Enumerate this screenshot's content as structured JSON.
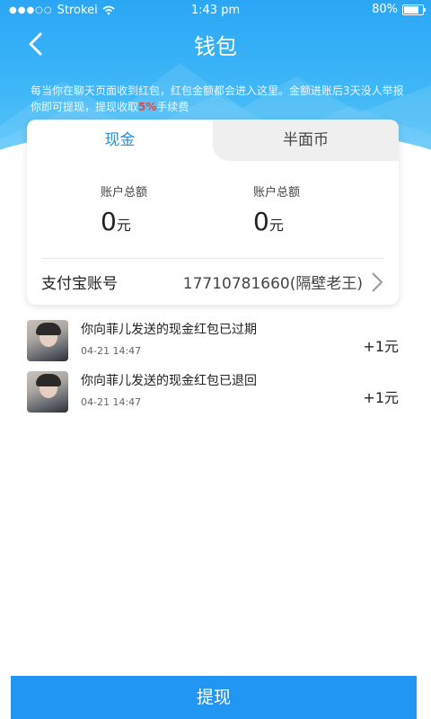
{
  "status_bar": {
    "carrier": "Strokei",
    "time": "1:43 pm",
    "battery": "80%"
  },
  "header": {
    "title": "钱包"
  },
  "notice": {
    "text_before": "每当你在聊天页面收到红包，红包金额都会进入这里。金额进账后3天没人举报你即可提现，提现收取",
    "highlight": "5%",
    "text_after": "手续费"
  },
  "tabs": [
    {
      "label": "现金"
    },
    {
      "label": "半面币"
    }
  ],
  "balances": {
    "cash": {
      "label": "账户总额",
      "amount": "0",
      "unit": "元"
    },
    "coin": {
      "label": "账户总额",
      "amount": "0",
      "unit": "元"
    }
  },
  "alipay": {
    "label": "支付宝账号",
    "value": "17710781660(隔壁老王)"
  },
  "transactions": [
    {
      "title": "你向菲儿发送的现金红包已过期",
      "time": "04-21 14:47",
      "amount": "+1元"
    },
    {
      "title": "你向菲儿发送的现金红包已退回",
      "time": "04-21 14:47",
      "amount": "+1元"
    }
  ],
  "footer": {
    "withdraw_label": "提现"
  },
  "colors": {
    "header": "#2aa6f5",
    "accent": "#2196f3",
    "tab_active": "#2a8de0",
    "highlight": "#e5473f"
  }
}
